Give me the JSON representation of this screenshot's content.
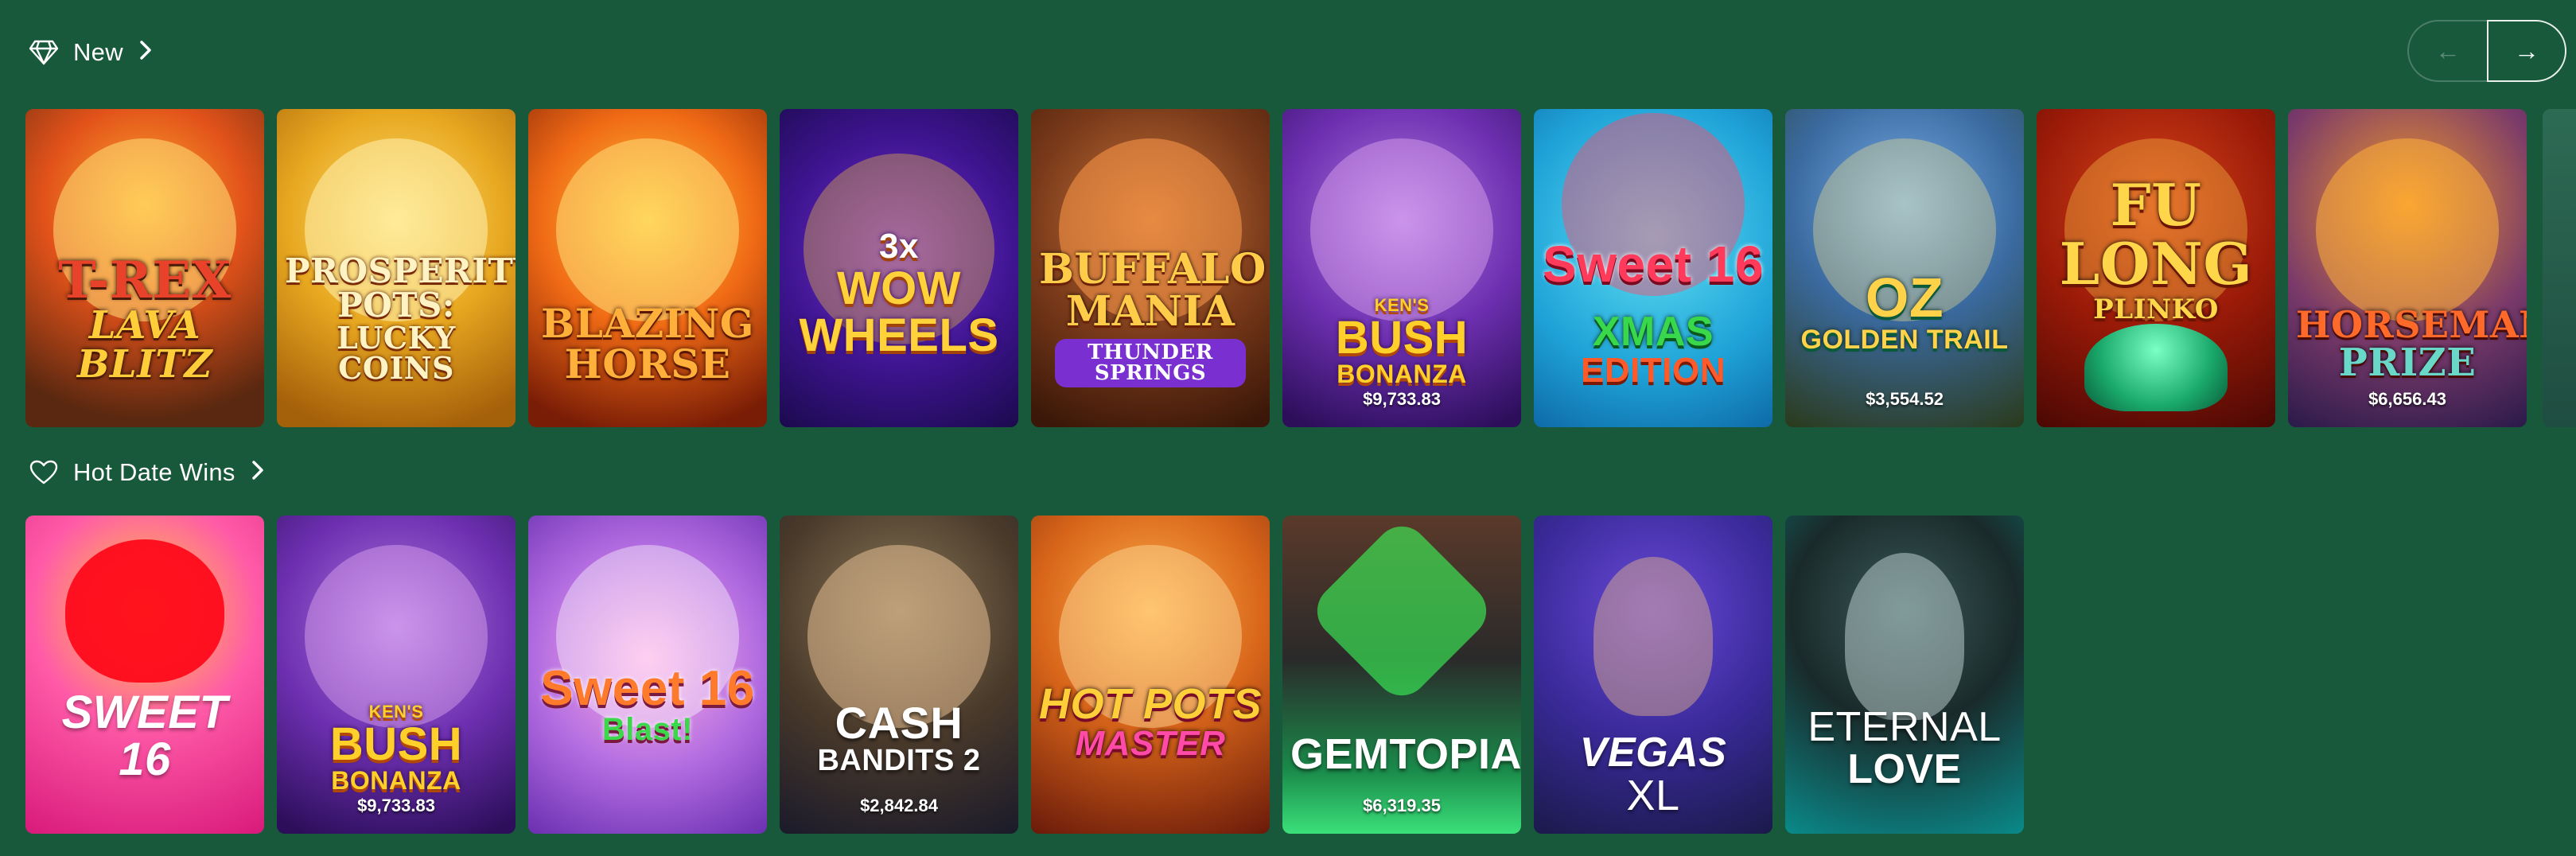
{
  "sections": {
    "new": {
      "title": "New",
      "icon": "diamond-icon"
    },
    "hot": {
      "title": "Hot Date Wins",
      "icon": "heart-icon"
    }
  },
  "nav": {
    "prev_icon": "arrow-left-icon",
    "next_icon": "arrow-right-icon",
    "prev_glyph": "←",
    "next_glyph": "→"
  },
  "new_games": [
    {
      "l1": "T-REX",
      "l2": "LAVA BLITZ",
      "jackpot": ""
    },
    {
      "l1": "PROSPERITY POTS:",
      "l2": "LUCKY COINS",
      "jackpot": ""
    },
    {
      "l1": "BLAZING",
      "l2": "HORSE",
      "jackpot": ""
    },
    {
      "l1": "3x",
      "l2": "WOW WHEELS",
      "jackpot": ""
    },
    {
      "l1": "BUFFALO",
      "l2": "MANIA",
      "l3": "THUNDER SPRINGS",
      "jackpot": ""
    },
    {
      "l0": "KEN'S",
      "l1": "BUSH",
      "l2": "BONANZA",
      "jackpot": "$9,733.83"
    },
    {
      "l0": "Sweet 16",
      "l1": "XMAS",
      "l2": "EDITION",
      "jackpot": ""
    },
    {
      "l1": "OZ",
      "l2": "GOLDEN TRAIL",
      "jackpot": "$3,554.52"
    },
    {
      "l1": "FU LONG",
      "l2": "PLINKO",
      "jackpot": ""
    },
    {
      "l1": "HORSEMAN'S",
      "l2": "PRIZE",
      "jackpot": "$6,656.43"
    }
  ],
  "hot_games": [
    {
      "l1": "SWEET",
      "l2": "16",
      "jackpot": ""
    },
    {
      "l0": "KEN'S",
      "l1": "BUSH",
      "l2": "BONANZA",
      "jackpot": "$9,733.83"
    },
    {
      "l1": "Sweet 16",
      "l2": "Blast!",
      "jackpot": ""
    },
    {
      "l1": "CASH",
      "l2": "BANDITS 2",
      "jackpot": "$2,842.84"
    },
    {
      "l1": "HOT POTS",
      "l2": "MASTER",
      "jackpot": ""
    },
    {
      "l1": "GEMTOPIA",
      "l2": "",
      "jackpot": "$6,319.35"
    },
    {
      "l1": "VEGAS",
      "l2": "XL",
      "jackpot": ""
    },
    {
      "l1": "ETERNAL",
      "l2": "LOVE",
      "jackpot": ""
    }
  ]
}
